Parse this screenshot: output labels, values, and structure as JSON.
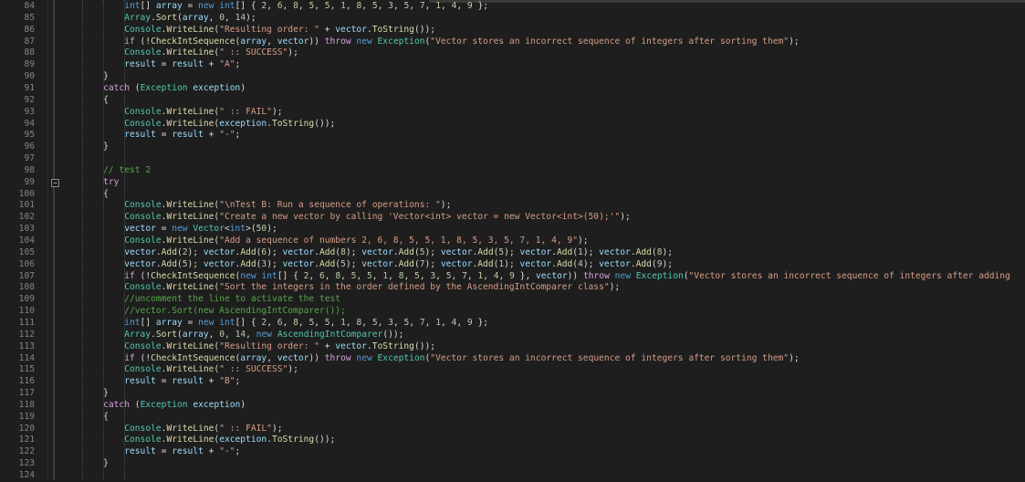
{
  "editor": {
    "lines": [
      {
        "n": "84",
        "t": "                int[] array = new int[] { 2, 6, 8, 5, 5, 1, 8, 5, 3, 5, 7, 1, 4, 9 };"
      },
      {
        "n": "85",
        "t": "                Array.Sort(array, 0, 14);"
      },
      {
        "n": "86",
        "t": "                Console.WriteLine(\"Resulting order: \" + vector.ToString());"
      },
      {
        "n": "87",
        "t": "                if (!CheckIntSequence(array, vector)) throw new Exception(\"Vector stores an incorrect sequence of integers after sorting them\");"
      },
      {
        "n": "88",
        "t": "                Console.WriteLine(\" :: SUCCESS\");"
      },
      {
        "n": "89",
        "t": "                result = result + \"A\";"
      },
      {
        "n": "90",
        "t": "            }"
      },
      {
        "n": "91",
        "t": "            catch (Exception exception)"
      },
      {
        "n": "92",
        "t": "            {"
      },
      {
        "n": "93",
        "t": "                Console.WriteLine(\" :: FAIL\");"
      },
      {
        "n": "94",
        "t": "                Console.WriteLine(exception.ToString());"
      },
      {
        "n": "95",
        "t": "                result = result + \"-\";"
      },
      {
        "n": "96",
        "t": "            }"
      },
      {
        "n": "97",
        "t": ""
      },
      {
        "n": "98",
        "t": "            // test 2"
      },
      {
        "n": "99",
        "t": "            try",
        "fold": "−"
      },
      {
        "n": "100",
        "t": "            {"
      },
      {
        "n": "101",
        "t": "                Console.WriteLine(\"\\nTest B: Run a sequence of operations: \");"
      },
      {
        "n": "102",
        "t": "                Console.WriteLine(\"Create a new vector by calling 'Vector<int> vector = new Vector<int>(50);'\");"
      },
      {
        "n": "103",
        "t": "                vector = new Vector<int>(50);"
      },
      {
        "n": "104",
        "t": "                Console.WriteLine(\"Add a sequence of numbers 2, 6, 8, 5, 5, 1, 8, 5, 3, 5, 7, 1, 4, 9\");"
      },
      {
        "n": "105",
        "t": "                vector.Add(2); vector.Add(6); vector.Add(8); vector.Add(5); vector.Add(5); vector.Add(1); vector.Add(8);"
      },
      {
        "n": "106",
        "t": "                vector.Add(5); vector.Add(3); vector.Add(5); vector.Add(7); vector.Add(1); vector.Add(4); vector.Add(9);"
      },
      {
        "n": "107",
        "t": "                if (!CheckIntSequence(new int[] { 2, 6, 8, 5, 5, 1, 8, 5, 3, 5, 7, 1, 4, 9 }, vector)) throw new Exception(\"Vector stores an incorrect sequence of integers after adding"
      },
      {
        "n": "108",
        "t": "                Console.WriteLine(\"Sort the integers in the order defined by the AscendingIntComparer class\");"
      },
      {
        "n": "109",
        "t": "                //uncomment the line to activate the test"
      },
      {
        "n": "110",
        "t": "                //vector.Sort(new AscendingIntComparer());"
      },
      {
        "n": "111",
        "t": "                int[] array = new int[] { 2, 6, 8, 5, 5, 1, 8, 5, 3, 5, 7, 1, 4, 9 };"
      },
      {
        "n": "112",
        "t": "                Array.Sort(array, 0, 14, new AscendingIntComparer());"
      },
      {
        "n": "113",
        "t": "                Console.WriteLine(\"Resulting order: \" + vector.ToString());"
      },
      {
        "n": "114",
        "t": "                if (!CheckIntSequence(array, vector)) throw new Exception(\"Vector stores an incorrect sequence of integers after sorting them\");"
      },
      {
        "n": "115",
        "t": "                Console.WriteLine(\" :: SUCCESS\");"
      },
      {
        "n": "116",
        "t": "                result = result + \"B\";"
      },
      {
        "n": "117",
        "t": "            }"
      },
      {
        "n": "118",
        "t": "            catch (Exception exception)"
      },
      {
        "n": "119",
        "t": "            {"
      },
      {
        "n": "120",
        "t": "                Console.WriteLine(\" :: FAIL\");"
      },
      {
        "n": "121",
        "t": "                Console.WriteLine(exception.ToString());"
      },
      {
        "n": "122",
        "t": "                result = result + \"-\";"
      },
      {
        "n": "123",
        "t": "            }"
      },
      {
        "n": "124",
        "t": ""
      }
    ]
  },
  "colors": {
    "background": "#1e1e1e",
    "line_number": "#858585",
    "keyword": "#569cd6",
    "control_keyword": "#d8a0df",
    "type": "#4ec9b0",
    "method": "#dcdcaa",
    "string": "#d69d85",
    "number": "#b5cea8",
    "variable": "#9cdcfe",
    "comment": "#57a64a"
  }
}
